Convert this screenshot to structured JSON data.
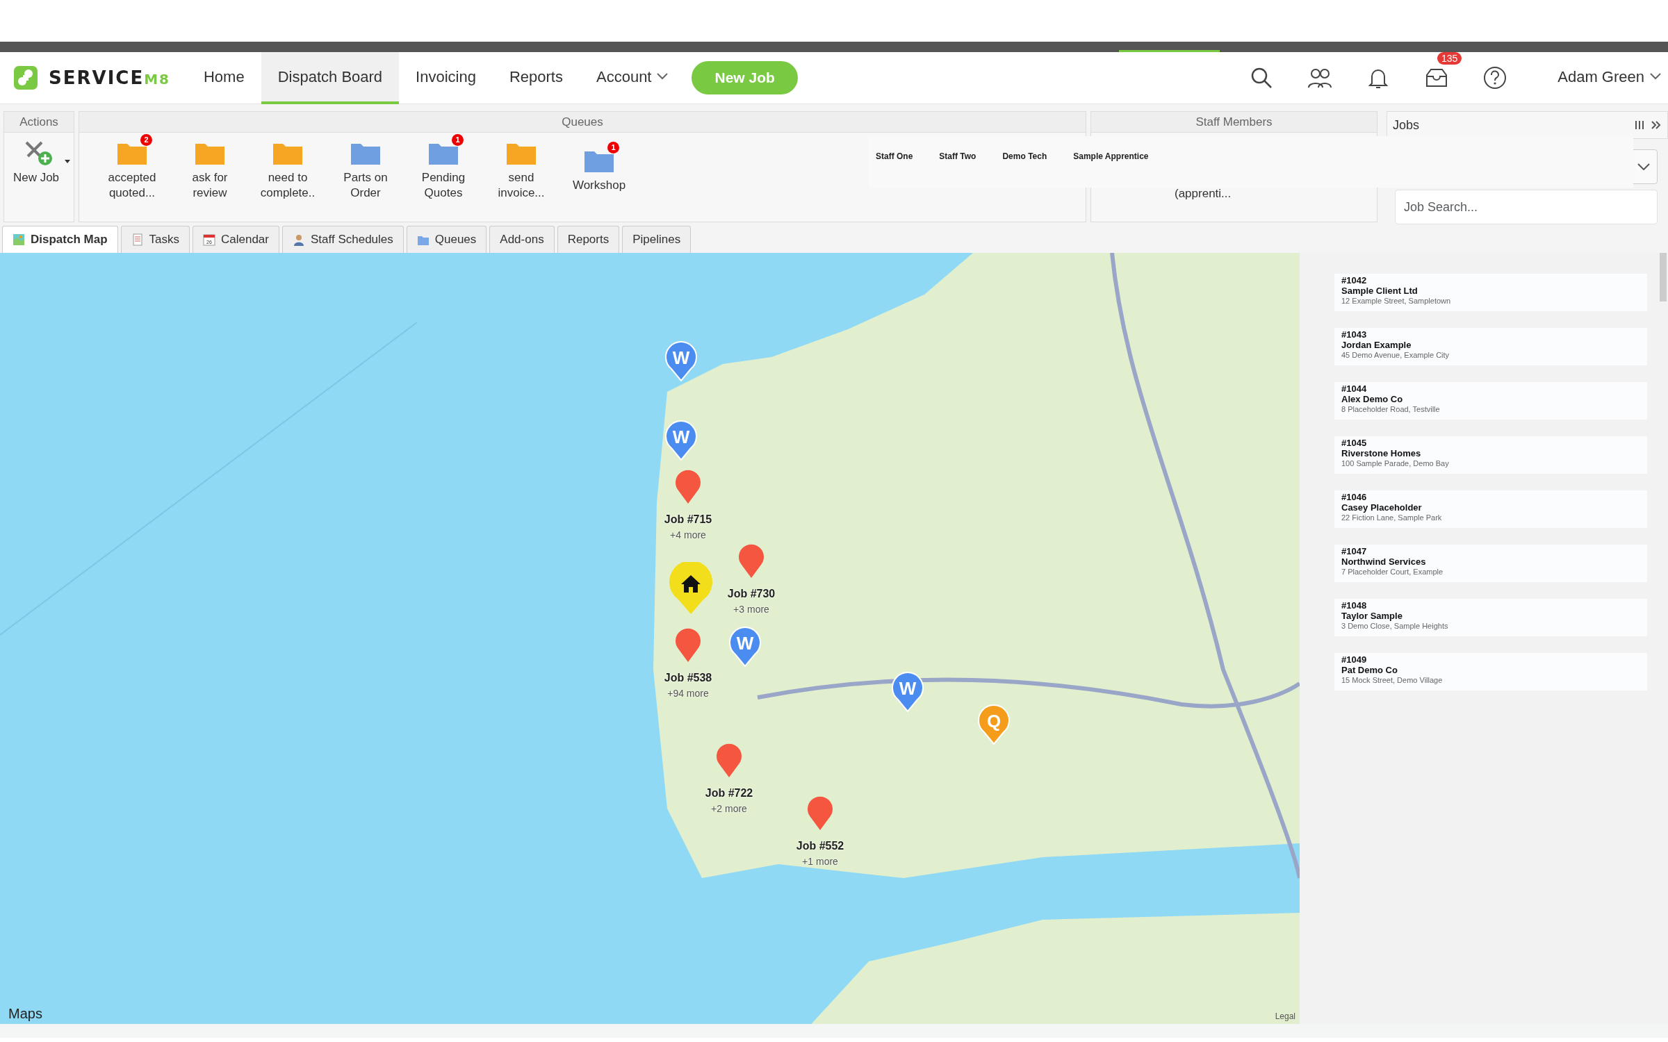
{
  "navbar": {
    "brand": "SERVICE",
    "brand_suffix": "M8",
    "items": [
      {
        "label": "Home",
        "selected": false,
        "kind": "link"
      },
      {
        "label": "Dispatch Board",
        "selected": true,
        "kind": "link"
      },
      {
        "label": "Invoicing",
        "selected": false,
        "kind": "link"
      },
      {
        "label": "Reports",
        "selected": false,
        "kind": "link"
      },
      {
        "label": "Account",
        "selected": false,
        "kind": "dropdown"
      }
    ],
    "new_job_button": "New Job",
    "inbox_badge": "135",
    "user": "Adam Green"
  },
  "actions": {
    "title": "Actions",
    "new_job": "New Job"
  },
  "queues": {
    "title": "Queues",
    "items": [
      {
        "label": "accepted quoted...",
        "color": "#f5a623",
        "badge": "2"
      },
      {
        "label": "ask for review",
        "color": "#f5a623"
      },
      {
        "label": "need to complete..",
        "color": "#f5a623"
      },
      {
        "label": "Parts on Order",
        "color": "#6f9fe0"
      },
      {
        "label": "Pending Quotes",
        "color": "#6f9fe0",
        "badge": "1"
      },
      {
        "label": "send invoice...",
        "color": "#f5a623"
      },
      {
        "label": "Workshop",
        "color": "#6f9fe0",
        "badge": "1"
      }
    ]
  },
  "staff_members": {
    "title": "Staff Members",
    "names": [
      "Staff One",
      "Staff Two",
      "Demo Tech",
      "Sample Apprentice"
    ],
    "partial_label": "(apprenti..."
  },
  "tabs": [
    {
      "label": "Dispatch Map",
      "selected": true
    },
    {
      "label": "Tasks",
      "selected": false
    },
    {
      "label": "Calendar",
      "selected": false,
      "icon_text": "26"
    },
    {
      "label": "Staff Schedules",
      "selected": false
    },
    {
      "label": "Queues",
      "selected": false
    },
    {
      "label": "Add-ons",
      "selected": false
    },
    {
      "label": "Reports",
      "selected": false
    },
    {
      "label": "Pipelines",
      "selected": false
    }
  ],
  "jobs_panel": {
    "title": "Jobs",
    "search": {
      "placeholder": "Job Search..."
    },
    "jobs": [
      {
        "number": "#1042",
        "client": "Sample Client Ltd",
        "address": "12 Example Street, Sampletown"
      },
      {
        "number": "#1043",
        "client": "Jordan Example",
        "address": "45 Demo Avenue, Example City"
      },
      {
        "number": "#1044",
        "client": "Alex Demo Co",
        "address": "8 Placeholder Road, Testville"
      },
      {
        "number": "#1045",
        "client": "Riverstone Homes",
        "address": "100 Sample Parade, Demo Bay"
      },
      {
        "number": "#1046",
        "client": "Casey Placeholder",
        "address": "22 Fiction Lane, Sample Park"
      },
      {
        "number": "#1047",
        "client": "Northwind Services",
        "address": "7 Placeholder Court, Example"
      },
      {
        "number": "#1048",
        "client": "Taylor Sample",
        "address": "3 Demo Close, Sample Heights"
      },
      {
        "number": "#1049",
        "client": "Pat Demo Co",
        "address": "15 Mock Street, Demo Village"
      }
    ]
  },
  "map": {
    "attribution": "Maps",
    "legal": "Legal",
    "markers": [
      {
        "kind": "staff",
        "letter": "W"
      },
      {
        "kind": "staff",
        "letter": "W"
      },
      {
        "kind": "job",
        "label": "Job #715",
        "more": "+4 more"
      },
      {
        "kind": "job",
        "label": "Job #730",
        "more": "+3 more"
      },
      {
        "kind": "home"
      },
      {
        "kind": "job",
        "label": "Job #538",
        "more": "+94 more"
      },
      {
        "kind": "staff",
        "letter": "W"
      },
      {
        "kind": "staff",
        "letter": "W"
      },
      {
        "kind": "quote",
        "letter": "Q"
      },
      {
        "kind": "job",
        "label": "Job #722",
        "more": "+2 more"
      },
      {
        "kind": "job",
        "label": "Job #552",
        "more": "+1 more"
      }
    ]
  }
}
